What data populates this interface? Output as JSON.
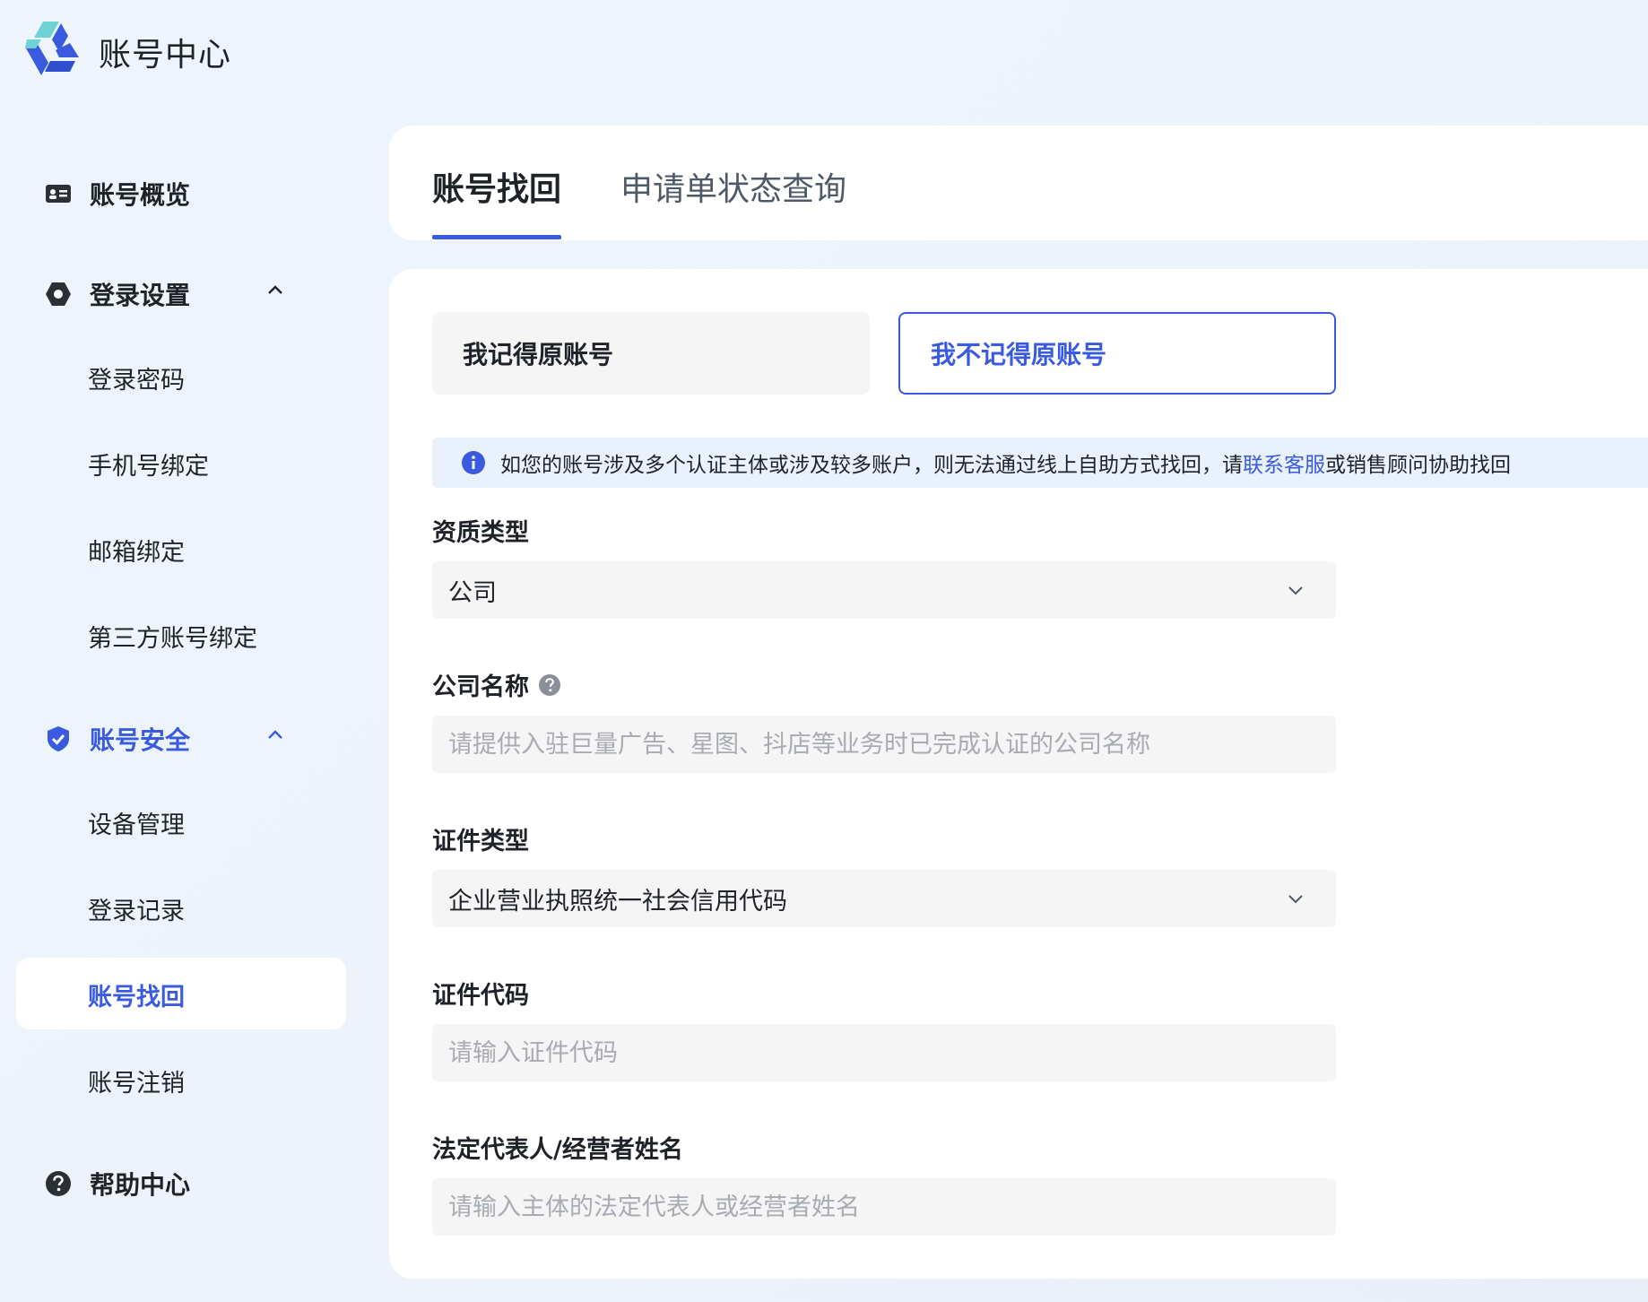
{
  "app": {
    "title": "账号中心"
  },
  "sidebar": {
    "overview": "账号概览",
    "login_settings": {
      "label": "登录设置",
      "items": [
        "登录密码",
        "手机号绑定",
        "邮箱绑定",
        "第三方账号绑定"
      ]
    },
    "account_security": {
      "label": "账号安全",
      "items": [
        "设备管理",
        "登录记录",
        "账号找回",
        "账号注销"
      ]
    },
    "help": "帮助中心"
  },
  "tabs": [
    "账号找回",
    "申请单状态查询"
  ],
  "segments": [
    "我记得原账号",
    "我不记得原账号"
  ],
  "notice": {
    "prefix": "如您的账号涉及多个认证主体或涉及较多账户，则无法通过线上自助方式找回，请",
    "link": "联系客服",
    "suffix": "或销售顾问协助找回"
  },
  "form": {
    "qualification_type": {
      "label": "资质类型",
      "value": "公司"
    },
    "company_name": {
      "label": "公司名称",
      "placeholder": "请提供入驻巨量广告、星图、抖店等业务时已完成认证的公司名称"
    },
    "certificate_type": {
      "label": "证件类型",
      "value": "企业营业执照统一社会信用代码"
    },
    "certificate_code": {
      "label": "证件代码",
      "placeholder": "请输入证件代码"
    },
    "legal_rep": {
      "label": "法定代表人/经营者姓名",
      "placeholder": "请输入主体的法定代表人或经营者姓名"
    }
  },
  "colors": {
    "accent": "#3a5be0",
    "notice_bg": "#e8f1fc",
    "field_bg": "#f5f5f5"
  }
}
